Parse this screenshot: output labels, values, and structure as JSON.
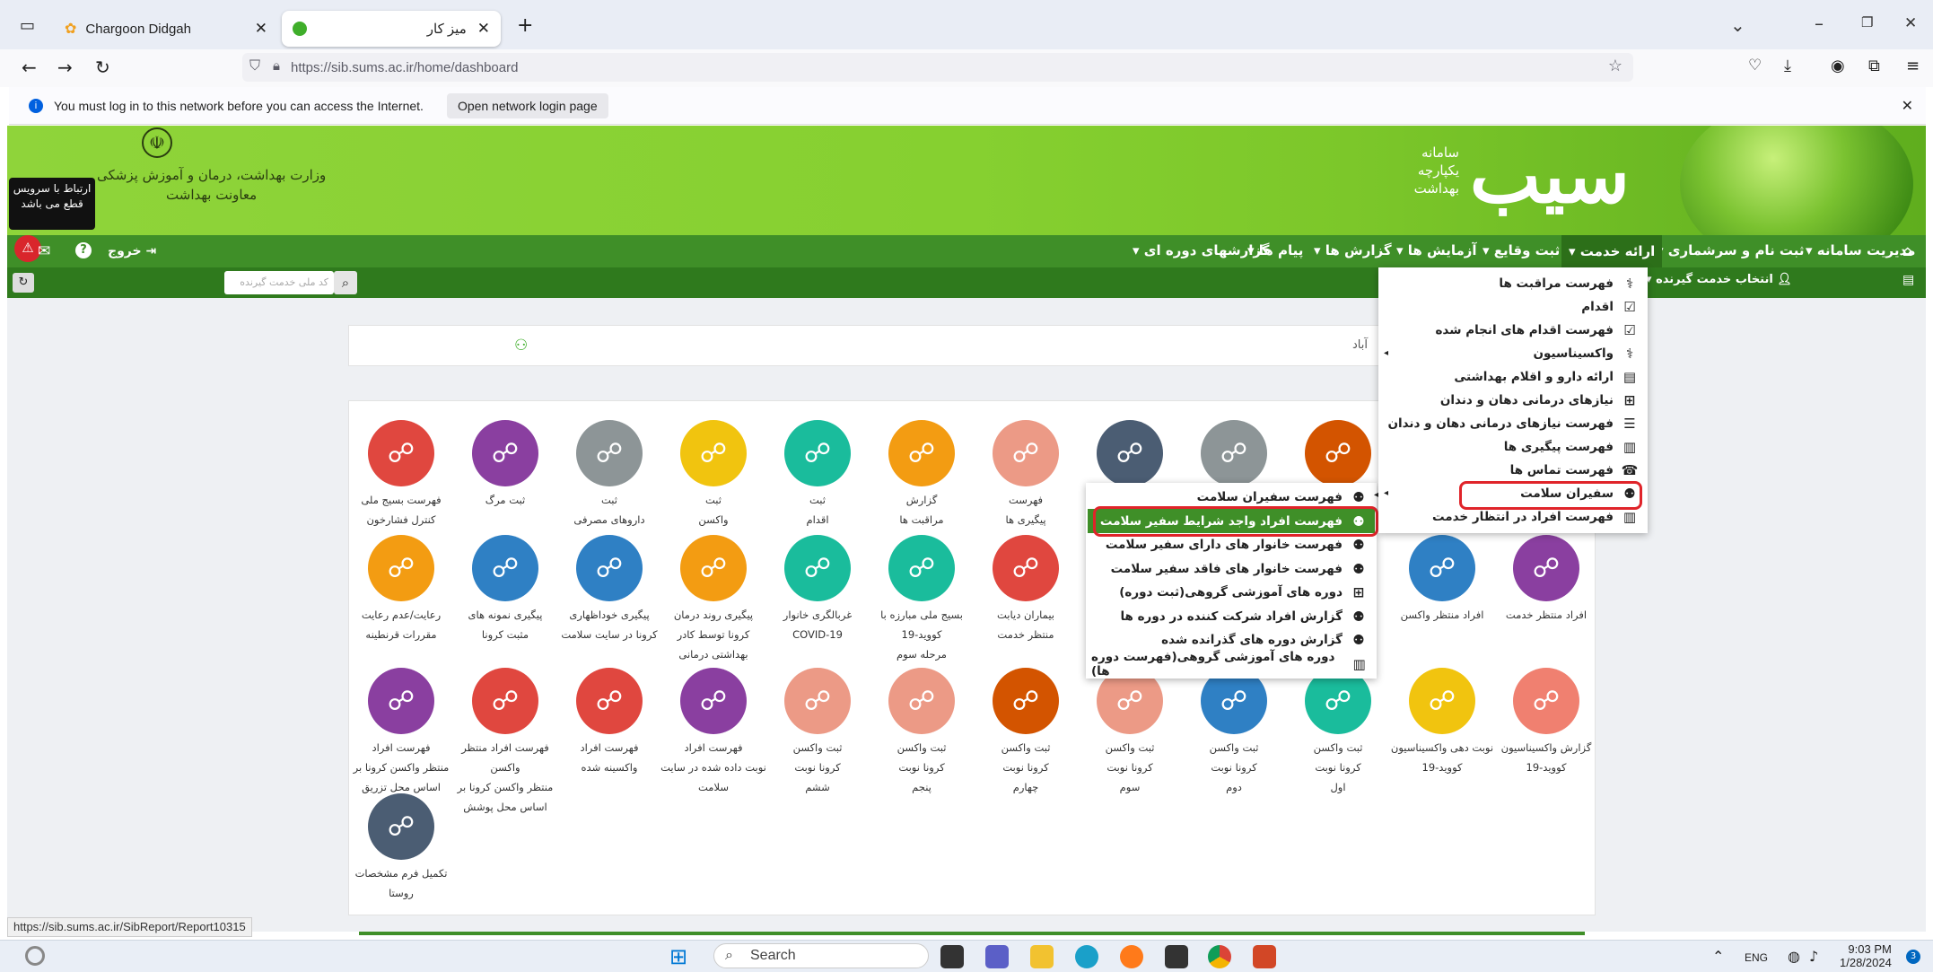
{
  "browser": {
    "tabs": [
      {
        "title": "Chargoon Didgah"
      },
      {
        "title": "میز کار"
      }
    ],
    "url": "https://sib.sums.ac.ir/home/dashboard",
    "notification": "You must log in to this network before you can access the Internet.",
    "notification_button": "Open network login page"
  },
  "header": {
    "tooltip": "ارتباط با سرویس قطع می باشد",
    "logout": "خروج",
    "ministry_lines": [
      "وزارت بهداشت، درمان و آموزش پزشکی",
      "معاونت بهداشت"
    ],
    "logo": "سیب",
    "logo_sub": [
      "سامانه",
      "یکپارچه",
      "بهداشت"
    ]
  },
  "menu": {
    "items": [
      "مدیریت سامانه",
      "ثبت نام و سرشماری",
      "ارائه خدمت",
      "ثبت وقایع",
      "آزمایش ها",
      "گزارش ها",
      "پیام ها",
      "گزارشهای دوره ای"
    ],
    "search_placeholder": "کد ملی خدمت گیرنده",
    "select_recipient": "انتخاب خدمت گیرنده"
  },
  "panel1_text": "آباد",
  "service_menu": [
    {
      "label": "فهرست مراقبت ها",
      "icon": "stethoscope-icon"
    },
    {
      "label": "اقدام",
      "icon": "check-icon"
    },
    {
      "label": "فهرست اقدام های انجام شده",
      "icon": "check-icon"
    },
    {
      "label": "واکسیناسیون",
      "icon": "stethoscope-icon"
    },
    {
      "label": "ارائه دارو و اقلام بهداشتی",
      "icon": "file-icon"
    },
    {
      "label": "نیازهای درمانی دهان و دندان",
      "icon": "plus-icon"
    },
    {
      "label": "فهرست نیازهای درمانی دهان و دندان",
      "icon": "list-icon"
    },
    {
      "label": "فهرست پیگیری ها",
      "icon": "chart-icon"
    },
    {
      "label": "فهرست تماس ها",
      "icon": "phone-icon"
    },
    {
      "label": "سفیران سلامت",
      "icon": "users-icon"
    },
    {
      "label": "فهرست افراد در انتظار خدمت",
      "icon": "chart-icon"
    }
  ],
  "ambassador_menu": [
    {
      "label": "فهرست سفیران سلامت",
      "icon": "users-icon"
    },
    {
      "label": "فهرست افراد واجد شرایط سفیر سلامت",
      "icon": "users-icon"
    },
    {
      "label": "فهرست خانوار های دارای سفیر سلامت",
      "icon": "users-icon"
    },
    {
      "label": "فهرست خانوار های فاقد سفیر سلامت",
      "icon": "users-icon"
    },
    {
      "label": "دوره های آموزشی گروهی(ثبت دوره)",
      "icon": "plus-icon"
    },
    {
      "label": "گزارش افراد شرکت کننده در دوره ها",
      "icon": "users-icon"
    },
    {
      "label": "گزارش دوره های گذرانده شده",
      "icon": "users-icon"
    },
    {
      "label": "دوره های آموزشی گروهی(فهرست دوره ها)",
      "icon": "chart-icon"
    }
  ],
  "tiles_row1": [
    {
      "label": "فهرست بسیج ملی\nکنترل فشارخون",
      "color": "#e0473f"
    },
    {
      "label": "ثبت مرگ",
      "color": "#8a3fa0"
    },
    {
      "label": "ثبت\nداروهای مصرفی",
      "color": "#8d9597"
    },
    {
      "label": "ثبت\nواکسن",
      "color": "#f1c40f"
    },
    {
      "label": "ثبت\nاقدام",
      "color": "#1abc9c"
    },
    {
      "label": "گزارش\nمراقبت ها",
      "color": "#f39c12"
    },
    {
      "label": "فهرست\nپیگیری ها",
      "color": "#ec9a86"
    },
    {
      "label": "",
      "color": "#4b5d73"
    },
    {
      "label": "",
      "color": "#8d9597"
    },
    {
      "label": "",
      "color": "#d35400"
    }
  ],
  "tiles_row2": [
    {
      "label": "رعایت/عدم رعایت\nمقررات قرنطینه",
      "color": "#f39c12"
    },
    {
      "label": "پیگیری نمونه های\nمثبت کرونا",
      "color": "#2f80c4"
    },
    {
      "label": "پیگیری خوداظهاری\nکرونا در سایت سلامت",
      "color": "#2f80c4"
    },
    {
      "label": "پیگیری روند درمان\nکرونا توسط کادر\nبهداشتی درمانی",
      "color": "#f39c12"
    },
    {
      "label": "غربالگری خانوار\nCOVID-19",
      "color": "#1abc9c"
    },
    {
      "label": "بسیج ملی مبارزه با\nکووید-19\nمرحله سوم",
      "color": "#1abc9c"
    },
    {
      "label": "بیماران دیابت\nمنتظر خدمت",
      "color": "#e0473f"
    },
    {
      "label": "افراد منتظر واکسن",
      "color": "#2f80c4"
    },
    {
      "label": "افراد منتظر خدمت",
      "color": "#8a3fa0"
    }
  ],
  "tiles_row3": [
    {
      "label": "فهرست افراد\nمنتظر واکسن کرونا بر\nاساس محل تزریق",
      "color": "#8a3fa0"
    },
    {
      "label": "فهرست افراد منتظر\nواکسن\nمنتظر واکسن کرونا بر\nاساس محل پوشش",
      "color": "#e0473f"
    },
    {
      "label": "فهرست افراد\nواکسینه شده",
      "color": "#e0473f"
    },
    {
      "label": "فهرست افراد\nنوبت داده شده در سایت\nسلامت",
      "color": "#8a3fa0"
    },
    {
      "label": "ثبت واکسن\nکرونا نوبت\nششم",
      "color": "#ec9a86"
    },
    {
      "label": "ثبت واکسن\nکرونا نوبت\nپنجم",
      "color": "#ec9a86"
    },
    {
      "label": "ثبت واکسن\nکرونا نوبت\nچهارم",
      "color": "#d35400"
    },
    {
      "label": "ثبت واکسن\nکرونا نوبت\nسوم",
      "color": "#ec9a86"
    },
    {
      "label": "ثبت واکسن\nکرونا نوبت\nدوم",
      "color": "#2f80c4"
    },
    {
      "label": "ثبت واکسن\nکرونا نوبت\nاول",
      "color": "#1abc9c"
    },
    {
      "label": "نوبت دهی واکسیناسیون\nکووید-19",
      "color": "#f1c40f"
    },
    {
      "label": "گزارش واکسیناسیون\nکووید-19",
      "color": "#f08070"
    }
  ],
  "tiles_row4": [
    {
      "label": "تکمیل فرم مشخصات\nروستا",
      "color": "#4b5d73"
    }
  ],
  "status_url": "https://sib.sums.ac.ir/SibReport/Report10315",
  "taskbar": {
    "search": "Search",
    "lang": "ENG",
    "time": "9:03 PM",
    "date": "1/28/2024",
    "badge": "3"
  }
}
